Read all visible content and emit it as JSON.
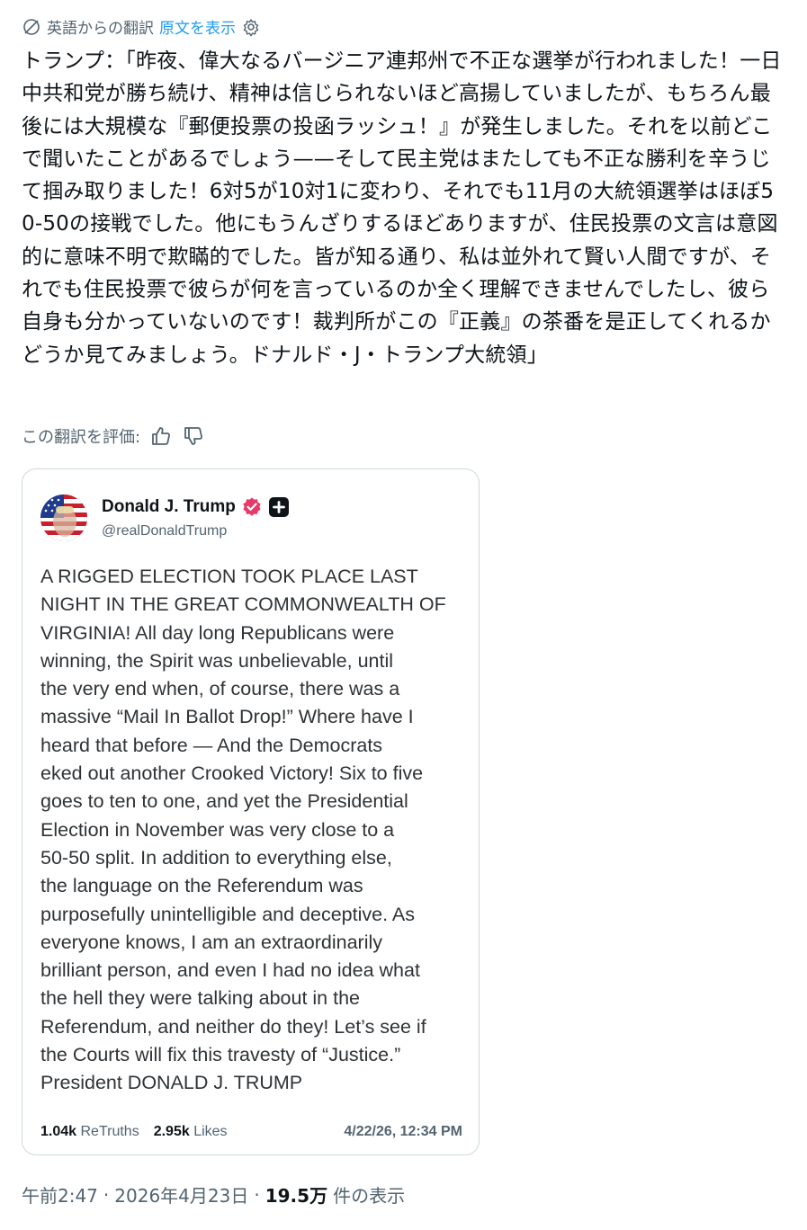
{
  "translation_bar": {
    "label": "英語からの翻訳",
    "show_original": "原文を表示",
    "translate_icon": "translate-icon",
    "settings_icon": "gear-icon"
  },
  "translated_text": "トランプ：「昨夜、偉大なるバージニア連邦州で不正な選挙が行われました！一日中共和党が勝ち続け、精神は信じられないほど高揚していましたが、もちろん最後には大規模な『郵便投票の投函ラッシュ！』が発生しました。それを以前どこで聞いたことがあるでしょう——そして民主党はまたしても不正な勝利を辛うじて掴み取りました！6対5が10対1に変わり、それでも11月の大統領選挙はほぼ50-50の接戦でした。他にもうんざりするほどありますが、住民投票の文言は意図的に意味不明で欺瞞的でした。皆が知る通り、私は並外れて賢い人間ですが、それでも住民投票で彼らが何を言っているのか全く理解できませんでしたし、彼ら自身も分かっていないのです！裁判所がこの『正義』の茶番を是正してくれるかどうか見てみましょう。ドナルド・J・トランプ大統領」",
  "rating": {
    "label": "この翻訳を評価:",
    "thumbs_up_icon": "thumbs-up-icon",
    "thumbs_down_icon": "thumbs-down-icon"
  },
  "card": {
    "display_name": "Donald J. Trump",
    "handle": "@realDonaldTrump",
    "verified_icon": "verified-badge-icon",
    "plus_icon": "plus-badge-icon",
    "post_text": "A RIGGED ELECTION TOOK PLACE LAST\nNIGHT IN THE GREAT COMMONWEALTH OF\nVIRGINIA! All day long Republicans were\nwinning, the Spirit was unbelievable, until\nthe very end when, of course, there was a\nmassive “Mail In Ballot Drop!” Where have I\nheard that before — And the Democrats\neked out another Crooked Victory! Six to five\ngoes to ten to one, and yet the Presidential\nElection in November was very close to a\n50-50 split. In addition to everything else,\nthe language on the Referendum was\npurposefully unintelligible and deceptive. As\neveryone knows, I am an extraordinarily\nbrilliant person, and even I had no idea what\nthe hell they were talking about in the\nReferendum, and neither do they! Let’s see if\nthe Courts will fix this travesty of “Justice.”\nPresident DONALD J. TRUMP",
    "retruths_count": "1.04k",
    "retruths_label": "ReTruths",
    "likes_count": "2.95k",
    "likes_label": "Likes",
    "date": "4/22/26, 12:34 PM"
  },
  "meta": {
    "time": "午前2:47",
    "separator": "·",
    "date": "2026年4月23日",
    "views_count": "19.5万",
    "views_label": "件の表示"
  },
  "colors": {
    "link": "#1d9bf0",
    "secondary": "#536471",
    "verified": "#e8396b"
  }
}
